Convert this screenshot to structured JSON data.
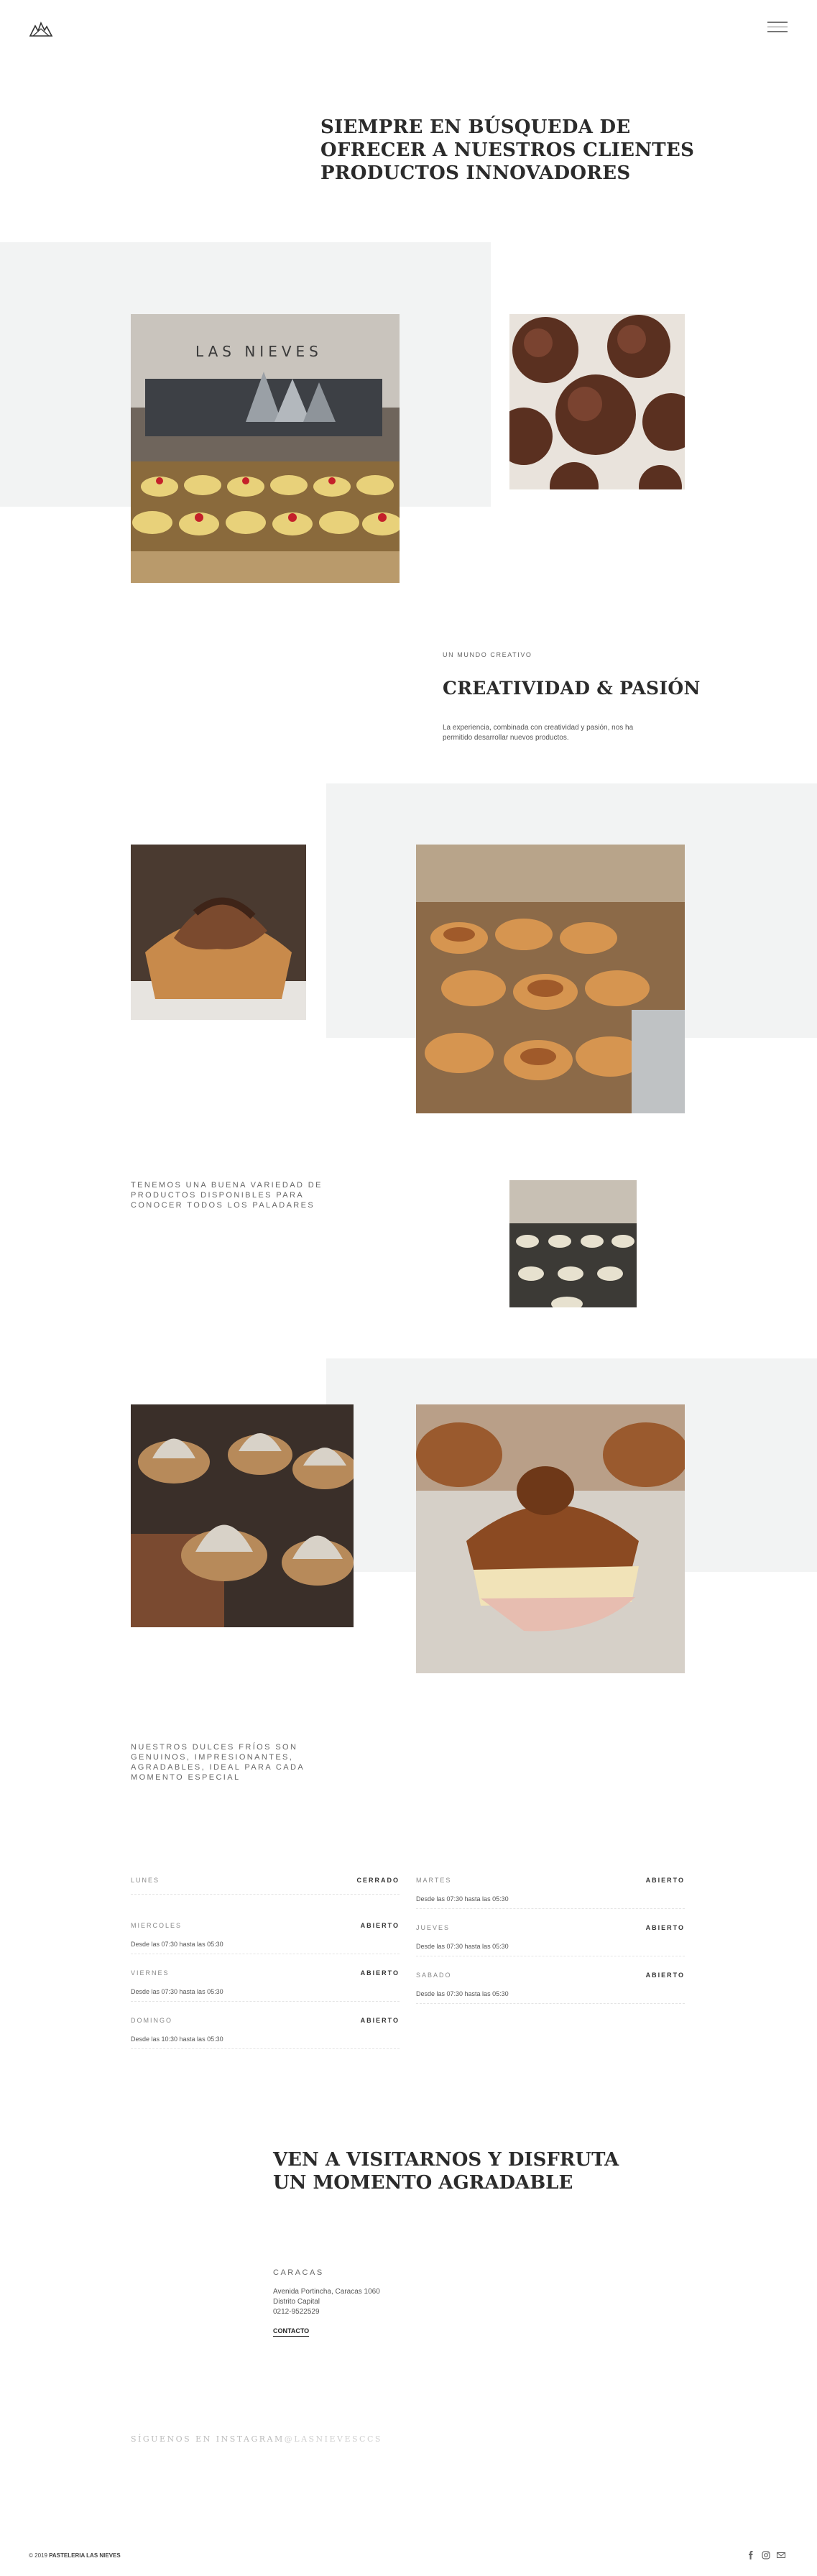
{
  "header": {
    "logo_icon": "mountains-logo-icon",
    "menu_icon": "hamburger-menu-icon"
  },
  "hero": {
    "title": "SIEMPRE EN BÚSQUEDA DE OFRECER A NUESTROS CLIENTES PRODUCTOS INNOVADORES"
  },
  "creative": {
    "eyebrow": "UN MUNDO CREATIVO",
    "title": "CREATIVIDAD & PASIÓN",
    "text": "La experiencia, combinada con creatividad y pasión, nos ha permitido desarrollar nuevos productos."
  },
  "variety": {
    "text": "TENEMOS UNA BUENA VARIEDAD DE PRODUCTOS DISPONIBLES PARA CONOCER TODOS LOS PALADARES"
  },
  "sweets": {
    "text": "NUESTROS DULCES FRÍOS SON GENUINOS, IMPRESIONANTES, AGRADABLES, IDEAL PARA CADA MOMENTO ESPECIAL"
  },
  "schedule": {
    "left": [
      {
        "day": "LUNES",
        "status": "CERRADO",
        "hours": ""
      },
      {
        "day": "MIERCOLES",
        "status": "ABIERTO",
        "hours": "Desde las 07:30 hasta las 05:30"
      },
      {
        "day": "VIERNES",
        "status": "ABIERTO",
        "hours": "Desde las 07:30 hasta las 05:30"
      },
      {
        "day": "DOMINGO",
        "status": "ABIERTO",
        "hours": "Desde las 10:30 hasta las 05:30"
      }
    ],
    "right": [
      {
        "day": "MARTES",
        "status": "ABIERTO",
        "hours": "Desde las 07:30 hasta las 05:30"
      },
      {
        "day": "JUEVES",
        "status": "ABIERTO",
        "hours": "Desde las 07:30 hasta las 05:30"
      },
      {
        "day": "SABADO",
        "status": "ABIERTO",
        "hours": "Desde las 07:30 hasta las 05:30"
      }
    ]
  },
  "visit": {
    "title": "VEN A VISITARNOS Y DISFRUTA UN MOMENTO AGRADABLE",
    "city": "CARACAS",
    "address_line1": "Avenida Portincha, Caracas 1060",
    "address_line2": "Distrito Capital",
    "phone": "0212-9522529",
    "contact_label": "CONTACTO"
  },
  "instagram": {
    "label": "SÍGUENOS EN INSTAGRAM",
    "handle": "@LASNIEVESCCS"
  },
  "footer": {
    "year": "© 2019",
    "brand": "PASTELERIA LAS NIEVES",
    "social_icons": [
      "facebook-icon",
      "instagram-icon",
      "email-icon"
    ]
  },
  "photos": {
    "store_sign": "LAS NIEVES"
  },
  "colors": {
    "gray_block": "#f2f3f3",
    "text_dark": "#2b2b2b"
  }
}
